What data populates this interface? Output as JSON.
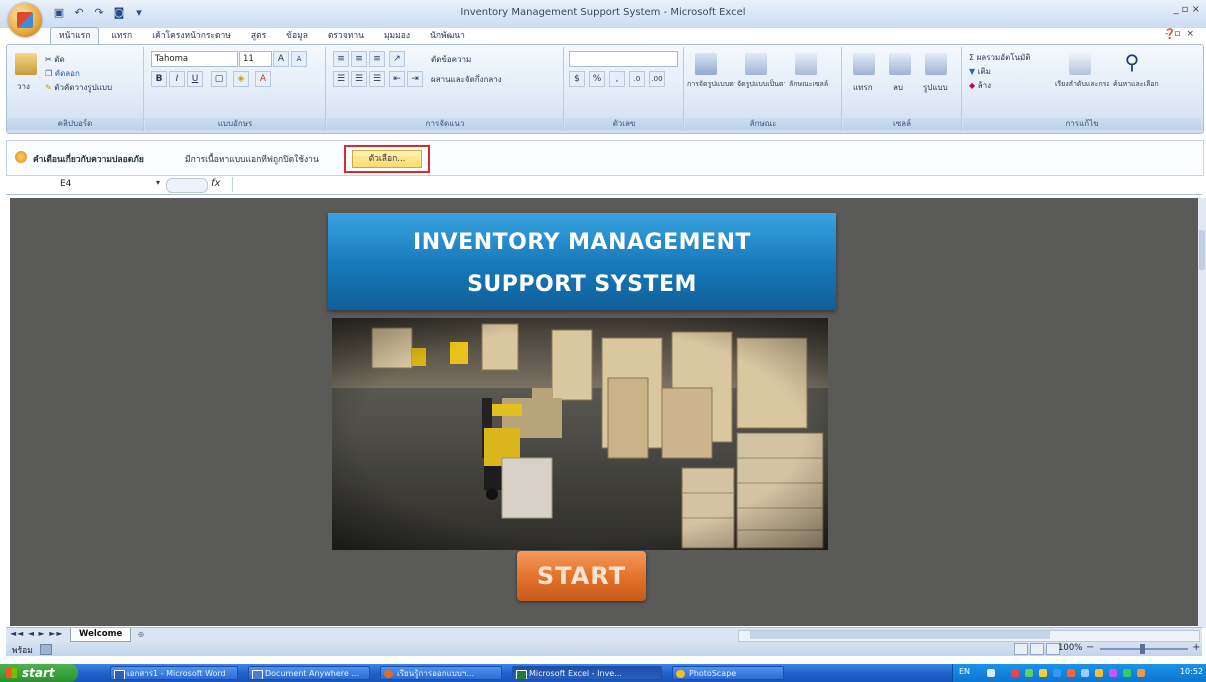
{
  "window": {
    "title": "Inventory Management Support System - Microsoft Excel",
    "controls": "_ ▫ ×"
  },
  "ribbon_tabs": [
    "หน้าแรก",
    "แทรก",
    "เค้าโครงหน้ากระดาษ",
    "สูตร",
    "ข้อมูล",
    "ตรวจทาน",
    "มุมมอง",
    "นักพัฒนา"
  ],
  "clipboard": {
    "cut": "ตัด",
    "copy": "คัดลอก",
    "paste": "วาง",
    "format_painter": "ตัวคัดวางรูปแบบ",
    "label": "คลิปบอร์ด"
  },
  "font": {
    "name": "Tahoma",
    "size": "11",
    "label": "แบบอักษร"
  },
  "alignment": {
    "wrap": "ตัดข้อความ",
    "merge": "ผสานและจัดกึ่งกลาง",
    "label": "การจัดแนว"
  },
  "number": {
    "label": "ตัวเลข"
  },
  "styles": {
    "conditional": "การจัดรูปแบบตามเงื่อนไข",
    "table": "จัดรูปแบบเป็นตาราง",
    "cell": "ลักษณะเซลล์",
    "label": "ลักษณะ"
  },
  "cells": {
    "insert": "แทรก",
    "delete": "ลบ",
    "format": "รูปแบบ",
    "label": "เซลล์"
  },
  "editing": {
    "autosum": "ผลรวมอัตโนมัติ",
    "fill": "เติม",
    "clear": "ล้าง",
    "sort": "เรียงลำดับและกรอง",
    "find": "ค้นหาและเลือก",
    "label": "การแก้ไข"
  },
  "security_bar": {
    "title": "คำเตือนเกี่ยวกับความปลอดภัย",
    "message": "มีการเนื้อหาแบบแอกทีฟถูกปิดใช้งาน",
    "options_button": "ตัวเลือก..."
  },
  "formula_bar": {
    "name_box": "E4",
    "fx": "fx",
    "value": ""
  },
  "sheet": {
    "banner_line1": "INVENTORY MANAGEMENT",
    "banner_line2": "SUPPORT SYSTEM",
    "start_button": "START"
  },
  "sheet_tabs": {
    "nav": "◄◄ ◄ ► ►►",
    "active": "Welcome"
  },
  "status_bar": {
    "ready": "พร้อม",
    "zoom": "100%",
    "minus": "−",
    "plus": "+"
  },
  "taskbar": {
    "start": "start",
    "items": [
      "เอกสาร1 - Microsoft Word",
      "Document Anywhere ...",
      "เรียนรู้การออกแบบฯ...",
      "Microsoft Excel - Inve...",
      "PhotoScape"
    ],
    "lang": "EN",
    "clock": "10:52"
  },
  "colors": {
    "banner": "#1778b9",
    "start_button": "#e0702a",
    "sheet_bg": "#5a5a59",
    "highlight_border": "#d92b2b"
  }
}
